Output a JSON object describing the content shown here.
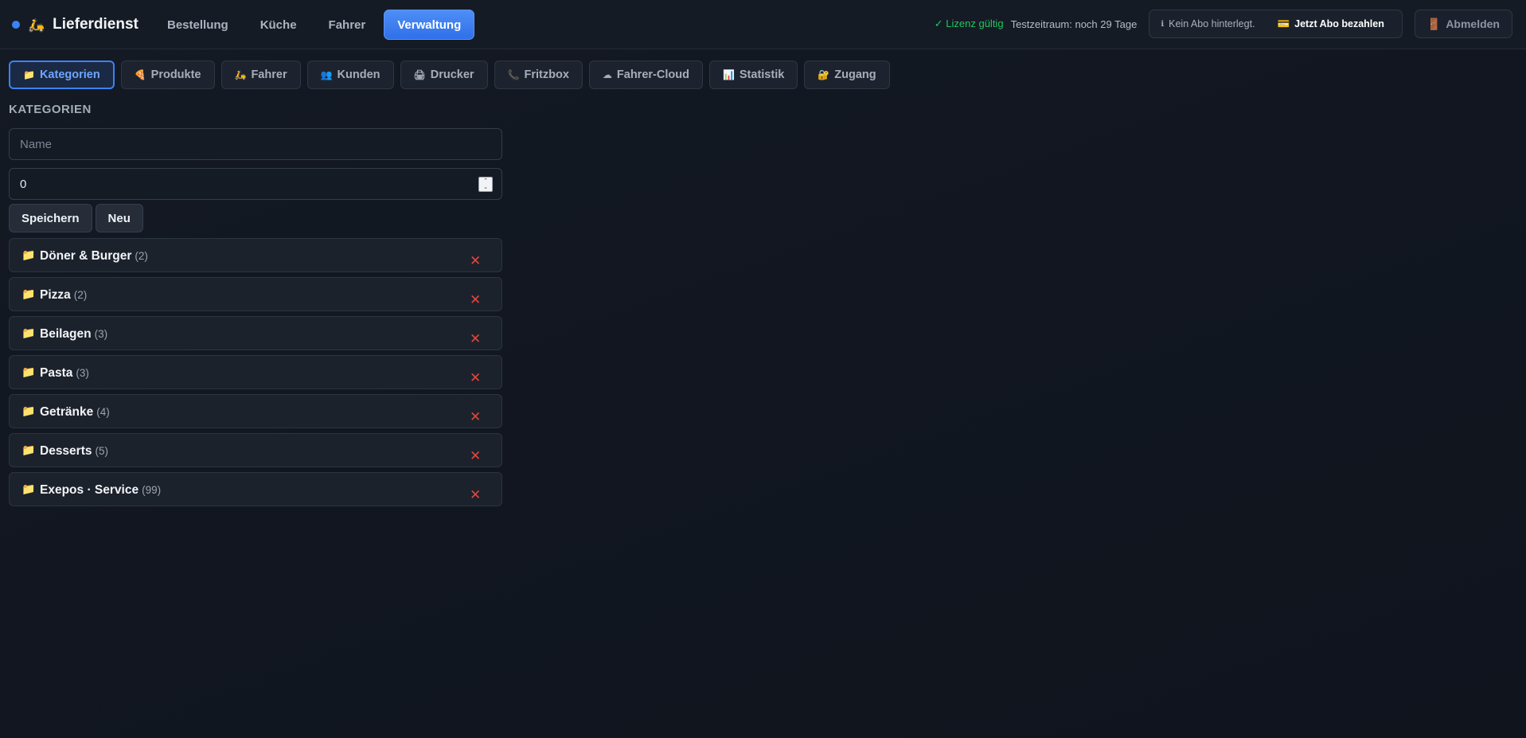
{
  "app": {
    "title": "Lieferdienst",
    "brand_emoji": "🛵",
    "accent": "#3b82f6"
  },
  "mainnav": [
    {
      "label": "Bestellung",
      "active": false
    },
    {
      "label": "Küche",
      "active": false
    },
    {
      "label": "Fahrer",
      "active": false
    },
    {
      "label": "Verwaltung",
      "active": true
    }
  ],
  "status": {
    "license": "✓ Lizenz gültig",
    "trial": "Testzeitraum: noch 29 Tage",
    "abo_info_icon": "ℹ",
    "abo_info": "Kein Abo hinterlegt.",
    "abo_pay_icon": "💳",
    "abo_pay": "Jetzt Abo bezahlen",
    "logout_icon": "🚪",
    "logout": "Abmelden"
  },
  "subnav": [
    {
      "icon": "📁",
      "label": "Kategorien",
      "active": true
    },
    {
      "icon": "🍕",
      "label": "Produkte",
      "active": false
    },
    {
      "icon": "🛵",
      "label": "Fahrer",
      "active": false
    },
    {
      "icon": "👥",
      "label": "Kunden",
      "active": false
    },
    {
      "icon": "🖨",
      "label": "Drucker",
      "active": false
    },
    {
      "icon": "📞",
      "label": "Fritzbox",
      "active": false
    },
    {
      "icon": "☁",
      "label": "Fahrer-Cloud",
      "active": false
    },
    {
      "icon": "📊",
      "label": "Statistik",
      "active": false
    },
    {
      "icon": "🔐",
      "label": "Zugang",
      "active": false
    }
  ],
  "form": {
    "section_title": "KATEGORIEN",
    "name_placeholder": "Name",
    "name_value": "",
    "sort_value": "0",
    "save_label": "Speichern",
    "new_label": "Neu"
  },
  "categories": [
    {
      "name": "Döner & Burger",
      "count": "(2)"
    },
    {
      "name": "Pizza",
      "count": "(2)"
    },
    {
      "name": "Beilagen",
      "count": "(3)"
    },
    {
      "name": "Pasta",
      "count": "(3)"
    },
    {
      "name": "Getränke",
      "count": "(4)"
    },
    {
      "name": "Desserts",
      "count": "(5)"
    },
    {
      "name": "Exepos · Service",
      "count": "(99)"
    }
  ],
  "icons": {
    "folder": "📁",
    "delete": "✕"
  }
}
